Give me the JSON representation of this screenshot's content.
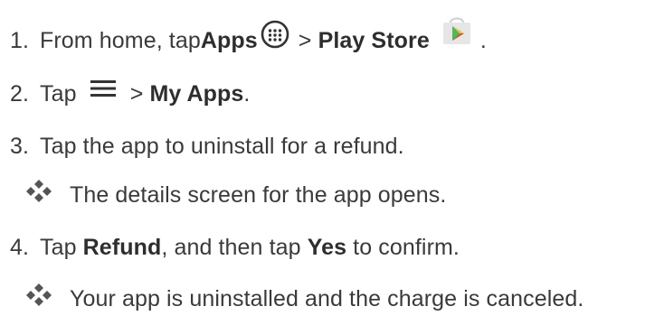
{
  "steps": [
    {
      "number": "1.",
      "text_a": "From home, tap ",
      "bold_a": "Apps",
      "text_b": " > ",
      "bold_b": "Play Store",
      "text_c": "."
    },
    {
      "number": "2.",
      "text_a": "Tap ",
      "text_b": " > ",
      "bold_b": "My Apps",
      "text_c": "."
    },
    {
      "number": "3.",
      "text_a": "Tap the app to uninstall for a refund."
    },
    {
      "number": "4.",
      "text_a": "Tap ",
      "bold_a": "Refund",
      "text_b": ", and then tap ",
      "bold_b": "Yes",
      "text_c": " to confirm."
    }
  ],
  "results": [
    "The details screen for the app opens.",
    "Your app is uninstalled and the charge is canceled."
  ],
  "icons": {
    "apps": "apps-icon",
    "menu": "menu-icon",
    "play_store": "play-store-icon",
    "bullet": "diamond-bullet-icon"
  },
  "colors": {
    "text": "#3a3a3a",
    "bullet": "#555555"
  }
}
